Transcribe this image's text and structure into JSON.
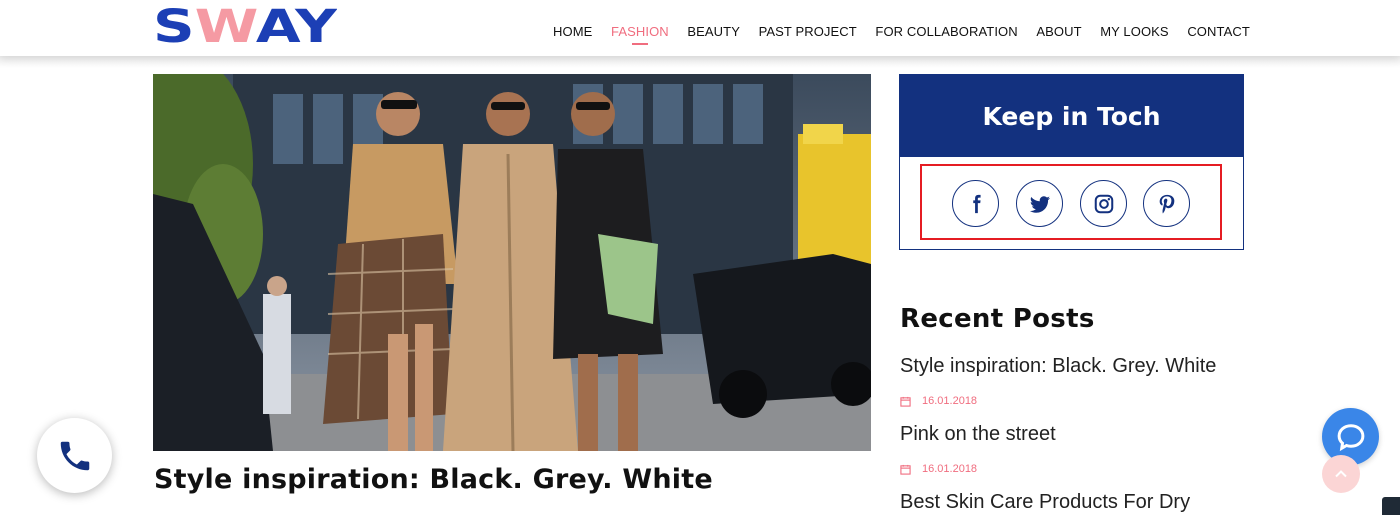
{
  "brand": {
    "logo_text": "SWAY",
    "primary_color": "#1c3fb5",
    "accent_color": "#f06d7f"
  },
  "nav": {
    "items": [
      {
        "label": "HOME"
      },
      {
        "label": "FASHION",
        "active": true
      },
      {
        "label": "BEAUTY"
      },
      {
        "label": "PAST PROJECT"
      },
      {
        "label": "FOR COLLABORATION"
      },
      {
        "label": "ABOUT"
      },
      {
        "label": "MY LOOKS"
      },
      {
        "label": "CONTACT"
      }
    ]
  },
  "post": {
    "title": "Style inspiration: Black. Grey. White"
  },
  "sidebar": {
    "keep_in_touch": {
      "title": "Keep in Toch",
      "header_color": "#13317f",
      "social": [
        {
          "icon": "facebook-icon"
        },
        {
          "icon": "twitter-icon"
        },
        {
          "icon": "instagram-icon"
        },
        {
          "icon": "pinterest-icon"
        }
      ]
    },
    "recent_posts": {
      "title": "Recent Posts",
      "items": [
        {
          "title": "Style inspiration: Black. Grey. White",
          "date": "16.01.2018"
        },
        {
          "title": "Pink on the street",
          "date": "16.01.2018"
        },
        {
          "title": "Best Skin Care Products For Dry"
        }
      ]
    }
  },
  "widgets": {
    "phone": {
      "icon": "phone-icon"
    },
    "chat": {
      "icon": "chat-icon",
      "color": "#3a86e8"
    },
    "back_to_top": {
      "icon": "chevron-up-icon"
    }
  }
}
